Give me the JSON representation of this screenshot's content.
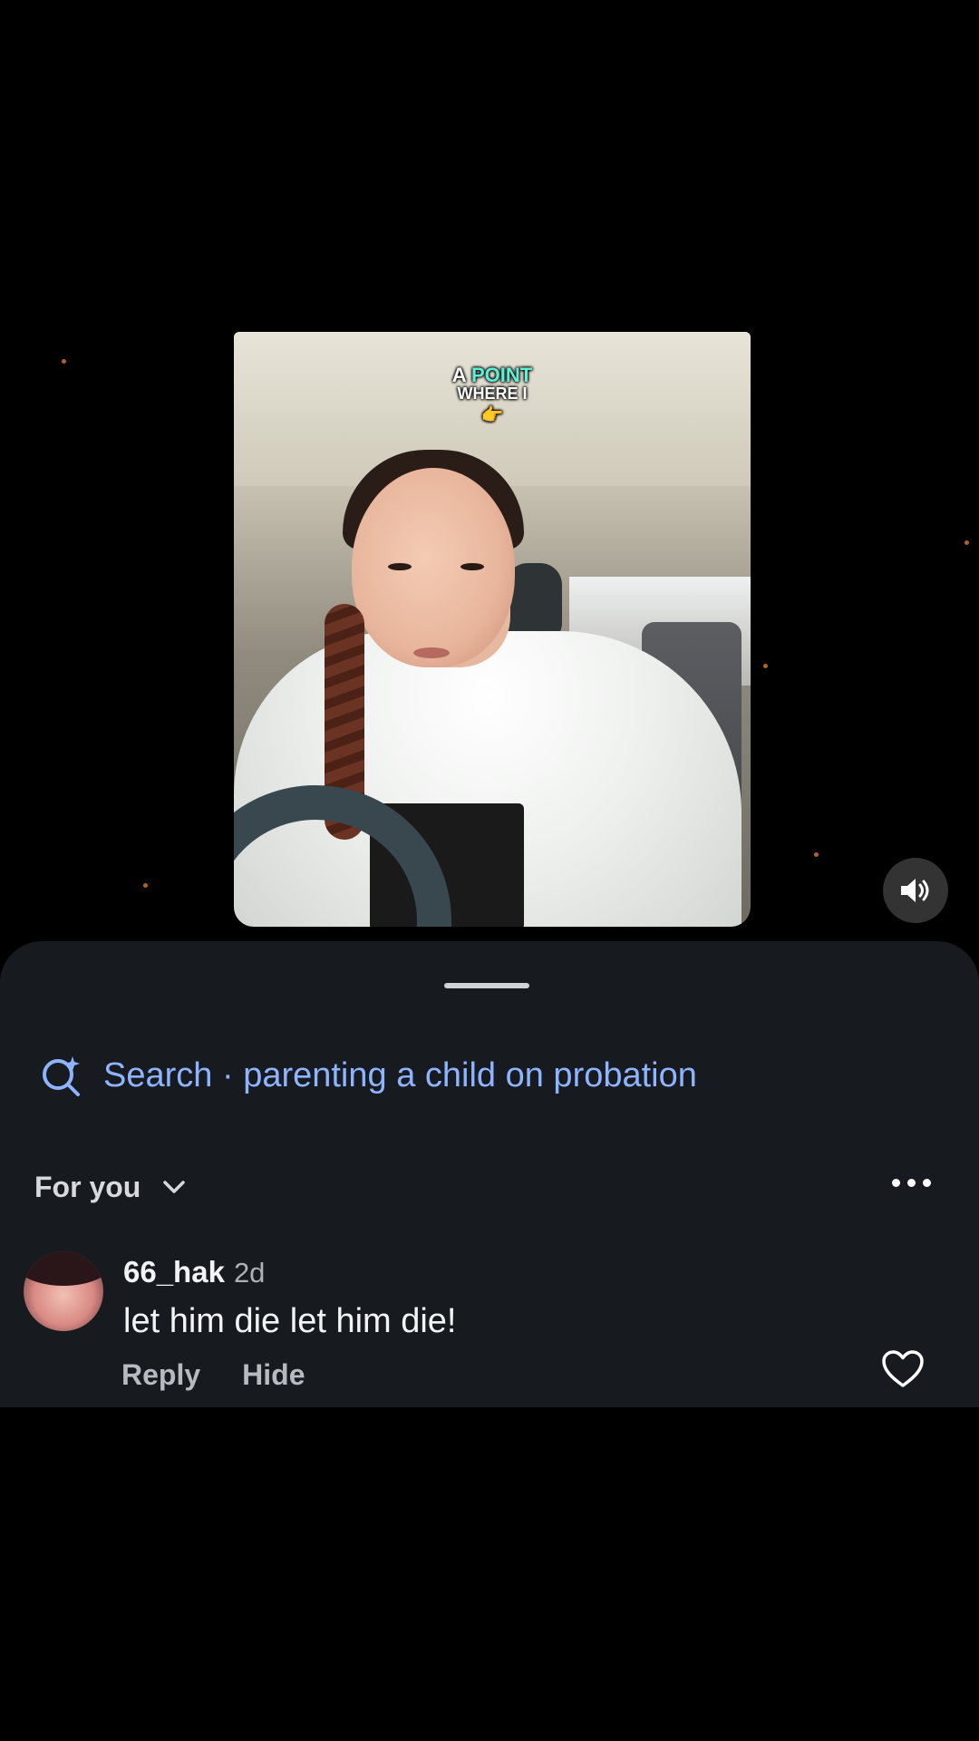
{
  "video": {
    "caption_word1": "A",
    "caption_highlight": "POINT",
    "caption_line2": "WHERE I",
    "caption_emoji": "👉",
    "sound_icon": "speaker-icon"
  },
  "comments_sheet": {
    "search": {
      "prefix": "Search",
      "separator": " · ",
      "query": "parenting a child on probation",
      "icon": "sparkle-search-icon"
    },
    "sort": {
      "label": "For you",
      "icon": "chevron-down-icon"
    },
    "more_icon": "more-options-icon",
    "comments": [
      {
        "username": "66_hak",
        "time": "2d",
        "text": "let him die let him die!",
        "reply_label": "Reply",
        "hide_label": "Hide",
        "like_icon": "heart-icon"
      }
    ]
  },
  "colors": {
    "sheet_bg": "#171b20",
    "search_text": "#8fb4ff",
    "caption_highlight": "#5ef0d5"
  }
}
